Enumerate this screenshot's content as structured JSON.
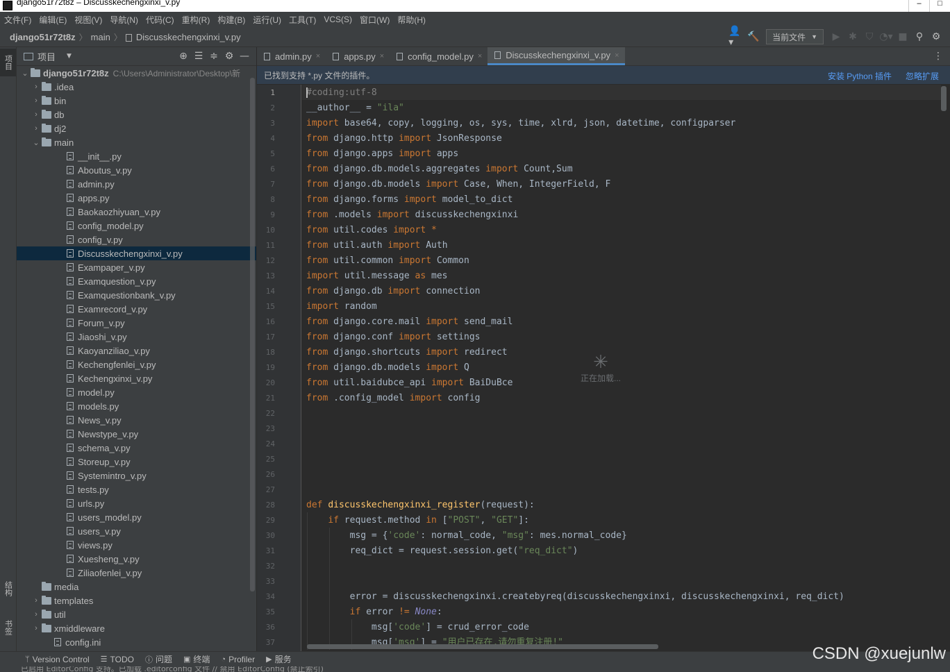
{
  "window": {
    "title": "django51r72t8z – Discusskechengxinxi_v.py"
  },
  "menu": [
    {
      "label": "文件(F)"
    },
    {
      "label": "编辑(E)"
    },
    {
      "label": "视图(V)"
    },
    {
      "label": "导航(N)"
    },
    {
      "label": "代码(C)"
    },
    {
      "label": "重构(R)"
    },
    {
      "label": "构建(B)"
    },
    {
      "label": "运行(U)"
    },
    {
      "label": "工具(T)"
    },
    {
      "label": "VCS(S)"
    },
    {
      "label": "窗口(W)"
    },
    {
      "label": "帮助(H)"
    }
  ],
  "breadcrumb": {
    "root": "django51r72t8z",
    "folder": "main",
    "file": "Discusskechengxinxi_v.py"
  },
  "toolbar": {
    "run_config": "当前文件"
  },
  "left_strip": {
    "project": "项目",
    "structure": "结构",
    "bookmarks": "书签"
  },
  "project_panel": {
    "title": "项目",
    "root_name": "django51r72t8z",
    "root_path": "C:\\Users\\Administrator\\Desktop\\新",
    "folders_top": [
      ".idea",
      "bin",
      "db",
      "dj2"
    ],
    "main_folder": "main",
    "main_files": [
      "__init__.py",
      "Aboutus_v.py",
      "admin.py",
      "apps.py",
      "Baokaozhiyuan_v.py",
      "config_model.py",
      "config_v.py",
      "Discusskechengxinxi_v.py",
      "Exampaper_v.py",
      "Examquestion_v.py",
      "Examquestionbank_v.py",
      "Examrecord_v.py",
      "Forum_v.py",
      "Jiaoshi_v.py",
      "Kaoyanziliao_v.py",
      "Kechengfenlei_v.py",
      "Kechengxinxi_v.py",
      "model.py",
      "models.py",
      "News_v.py",
      "Newstype_v.py",
      "schema_v.py",
      "Storeup_v.py",
      "Systemintro_v.py",
      "tests.py",
      "urls.py",
      "users_model.py",
      "users_v.py",
      "views.py",
      "Xuesheng_v.py",
      "Ziliaofenlei_v.py"
    ],
    "folders_bottom": [
      {
        "name": "media",
        "expandable": false
      },
      {
        "name": "templates",
        "expandable": true
      },
      {
        "name": "util",
        "expandable": true
      },
      {
        "name": "xmiddleware",
        "expandable": true
      }
    ],
    "last_file": "config.ini"
  },
  "tabs": [
    {
      "label": "admin.py"
    },
    {
      "label": "apps.py"
    },
    {
      "label": "config_model.py"
    },
    {
      "label": "Discusskechengxinxi_v.py"
    }
  ],
  "banner": {
    "message": "已找到支持 *.py 文件的插件。",
    "install": "安装 Python 插件",
    "ignore": "忽略扩展"
  },
  "loading_text": "正在加载...",
  "code": {
    "first_line": 1,
    "last_line": 37,
    "lines": [
      [
        [
          "cmt",
          "#coding:utf-8"
        ]
      ],
      [
        [
          "",
          "__author__ = "
        ],
        [
          "str",
          "\"ila\""
        ]
      ],
      [
        [
          "kw",
          "import "
        ],
        [
          "",
          "base64, copy, logging, os, sys, time, xlrd, json, datetime, configparser"
        ]
      ],
      [
        [
          "kw",
          "from "
        ],
        [
          "",
          "django.http "
        ],
        [
          "kw",
          "import "
        ],
        [
          "",
          "JsonResponse"
        ]
      ],
      [
        [
          "kw",
          "from "
        ],
        [
          "",
          "django.apps "
        ],
        [
          "kw",
          "import "
        ],
        [
          "",
          "apps"
        ]
      ],
      [
        [
          "kw",
          "from "
        ],
        [
          "",
          "django.db.models.aggregates "
        ],
        [
          "kw",
          "import "
        ],
        [
          "",
          "Count,Sum"
        ]
      ],
      [
        [
          "kw",
          "from "
        ],
        [
          "",
          "django.db.models "
        ],
        [
          "kw",
          "import "
        ],
        [
          "",
          "Case, When, IntegerField, F"
        ]
      ],
      [
        [
          "kw",
          "from "
        ],
        [
          "",
          "django.forms "
        ],
        [
          "kw",
          "import "
        ],
        [
          "",
          "model_to_dict"
        ]
      ],
      [
        [
          "kw",
          "from "
        ],
        [
          "",
          ".models "
        ],
        [
          "kw",
          "import "
        ],
        [
          "",
          "discusskechengxinxi"
        ]
      ],
      [
        [
          "kw",
          "from "
        ],
        [
          "",
          "util.codes "
        ],
        [
          "kw",
          "import "
        ],
        [
          "kw",
          "*"
        ]
      ],
      [
        [
          "kw",
          "from "
        ],
        [
          "",
          "util.auth "
        ],
        [
          "kw",
          "import "
        ],
        [
          "",
          "Auth"
        ]
      ],
      [
        [
          "kw",
          "from "
        ],
        [
          "",
          "util.common "
        ],
        [
          "kw",
          "import "
        ],
        [
          "",
          "Common"
        ]
      ],
      [
        [
          "kw",
          "import "
        ],
        [
          "",
          "util.message "
        ],
        [
          "kw",
          "as "
        ],
        [
          "",
          "mes"
        ]
      ],
      [
        [
          "kw",
          "from "
        ],
        [
          "",
          "django.db "
        ],
        [
          "kw",
          "import "
        ],
        [
          "",
          "connection"
        ]
      ],
      [
        [
          "kw",
          "import "
        ],
        [
          "",
          "random"
        ]
      ],
      [
        [
          "kw",
          "from "
        ],
        [
          "",
          "django.core.mail "
        ],
        [
          "kw",
          "import "
        ],
        [
          "",
          "send_mail"
        ]
      ],
      [
        [
          "kw",
          "from "
        ],
        [
          "",
          "django.conf "
        ],
        [
          "kw",
          "import "
        ],
        [
          "",
          "settings"
        ]
      ],
      [
        [
          "kw",
          "from "
        ],
        [
          "",
          "django.shortcuts "
        ],
        [
          "kw",
          "import "
        ],
        [
          "",
          "redirect"
        ]
      ],
      [
        [
          "kw",
          "from "
        ],
        [
          "",
          "django.db.models "
        ],
        [
          "kw",
          "import "
        ],
        [
          "",
          "Q"
        ]
      ],
      [
        [
          "kw",
          "from "
        ],
        [
          "",
          "util.baidubce_api "
        ],
        [
          "kw",
          "import "
        ],
        [
          "",
          "BaiDuBce"
        ]
      ],
      [
        [
          "kw",
          "from "
        ],
        [
          "",
          ".config_model "
        ],
        [
          "kw",
          "import "
        ],
        [
          "",
          "config"
        ]
      ],
      [],
      [],
      [],
      [],
      [],
      [],
      [
        [
          "kw",
          "def "
        ],
        [
          "fn",
          "discusskechengxinxi_register"
        ],
        [
          "",
          "(request):"
        ]
      ],
      [
        [
          "",
          "    "
        ],
        [
          "kw",
          "if "
        ],
        [
          "",
          "request.method "
        ],
        [
          "kw",
          "in "
        ],
        [
          "",
          "["
        ],
        [
          "str",
          "\"POST\""
        ],
        [
          "",
          ", "
        ],
        [
          "str",
          "\"GET\""
        ],
        [
          "",
          "]:"
        ]
      ],
      [
        [
          "",
          "        msg = {"
        ],
        [
          "str",
          "'code'"
        ],
        [
          "",
          ": normal_code, "
        ],
        [
          "str",
          "\"msg\""
        ],
        [
          "",
          ": mes.normal_code}"
        ]
      ],
      [
        [
          "",
          "        req_dict = request.session.get("
        ],
        [
          "str",
          "\"req_dict\""
        ],
        [
          "",
          ")"
        ]
      ],
      [],
      [],
      [
        [
          "",
          "        error = discusskechengxinxi.createbyreq(discusskechengxinxi, discusskechengxinxi, req_dict)"
        ]
      ],
      [
        [
          "",
          "        "
        ],
        [
          "kw",
          "if "
        ],
        [
          "",
          "error "
        ],
        [
          "kw",
          "!= "
        ],
        [
          "builtin italic",
          "None"
        ],
        [
          "",
          ":"
        ]
      ],
      [
        [
          "",
          "            msg["
        ],
        [
          "str",
          "'code'"
        ],
        [
          "",
          "] = crud_error_code"
        ]
      ],
      [
        [
          "",
          "            msg["
        ],
        [
          "str",
          "'msg'"
        ],
        [
          "",
          "] = "
        ],
        [
          "str",
          "\"用户已存在,请勿重复注册!\""
        ]
      ]
    ]
  },
  "bottom_tabs": [
    {
      "label": "Version Control",
      "icon": "branch-icon"
    },
    {
      "label": "TODO",
      "icon": "list-icon"
    },
    {
      "label": "问题",
      "icon": "info-icon"
    },
    {
      "label": "终端",
      "icon": "terminal-icon"
    },
    {
      "label": "Profiler",
      "icon": "profiler-icon"
    },
    {
      "label": "服务",
      "icon": "play-icon"
    }
  ],
  "status_text": "已启用 EditorConfig 支持。已加载 .editorconfig 文件 // 禁用 EditorConfig (禁止索引)",
  "watermark": "CSDN @xuejunlw",
  "colors": {
    "keyword": "#cc7832",
    "string": "#6a8759",
    "comment": "#808080",
    "function": "#ffc66d",
    "link": "#589df6",
    "selection": "#0d293e",
    "active_tab_underline": "#4a88c7"
  }
}
